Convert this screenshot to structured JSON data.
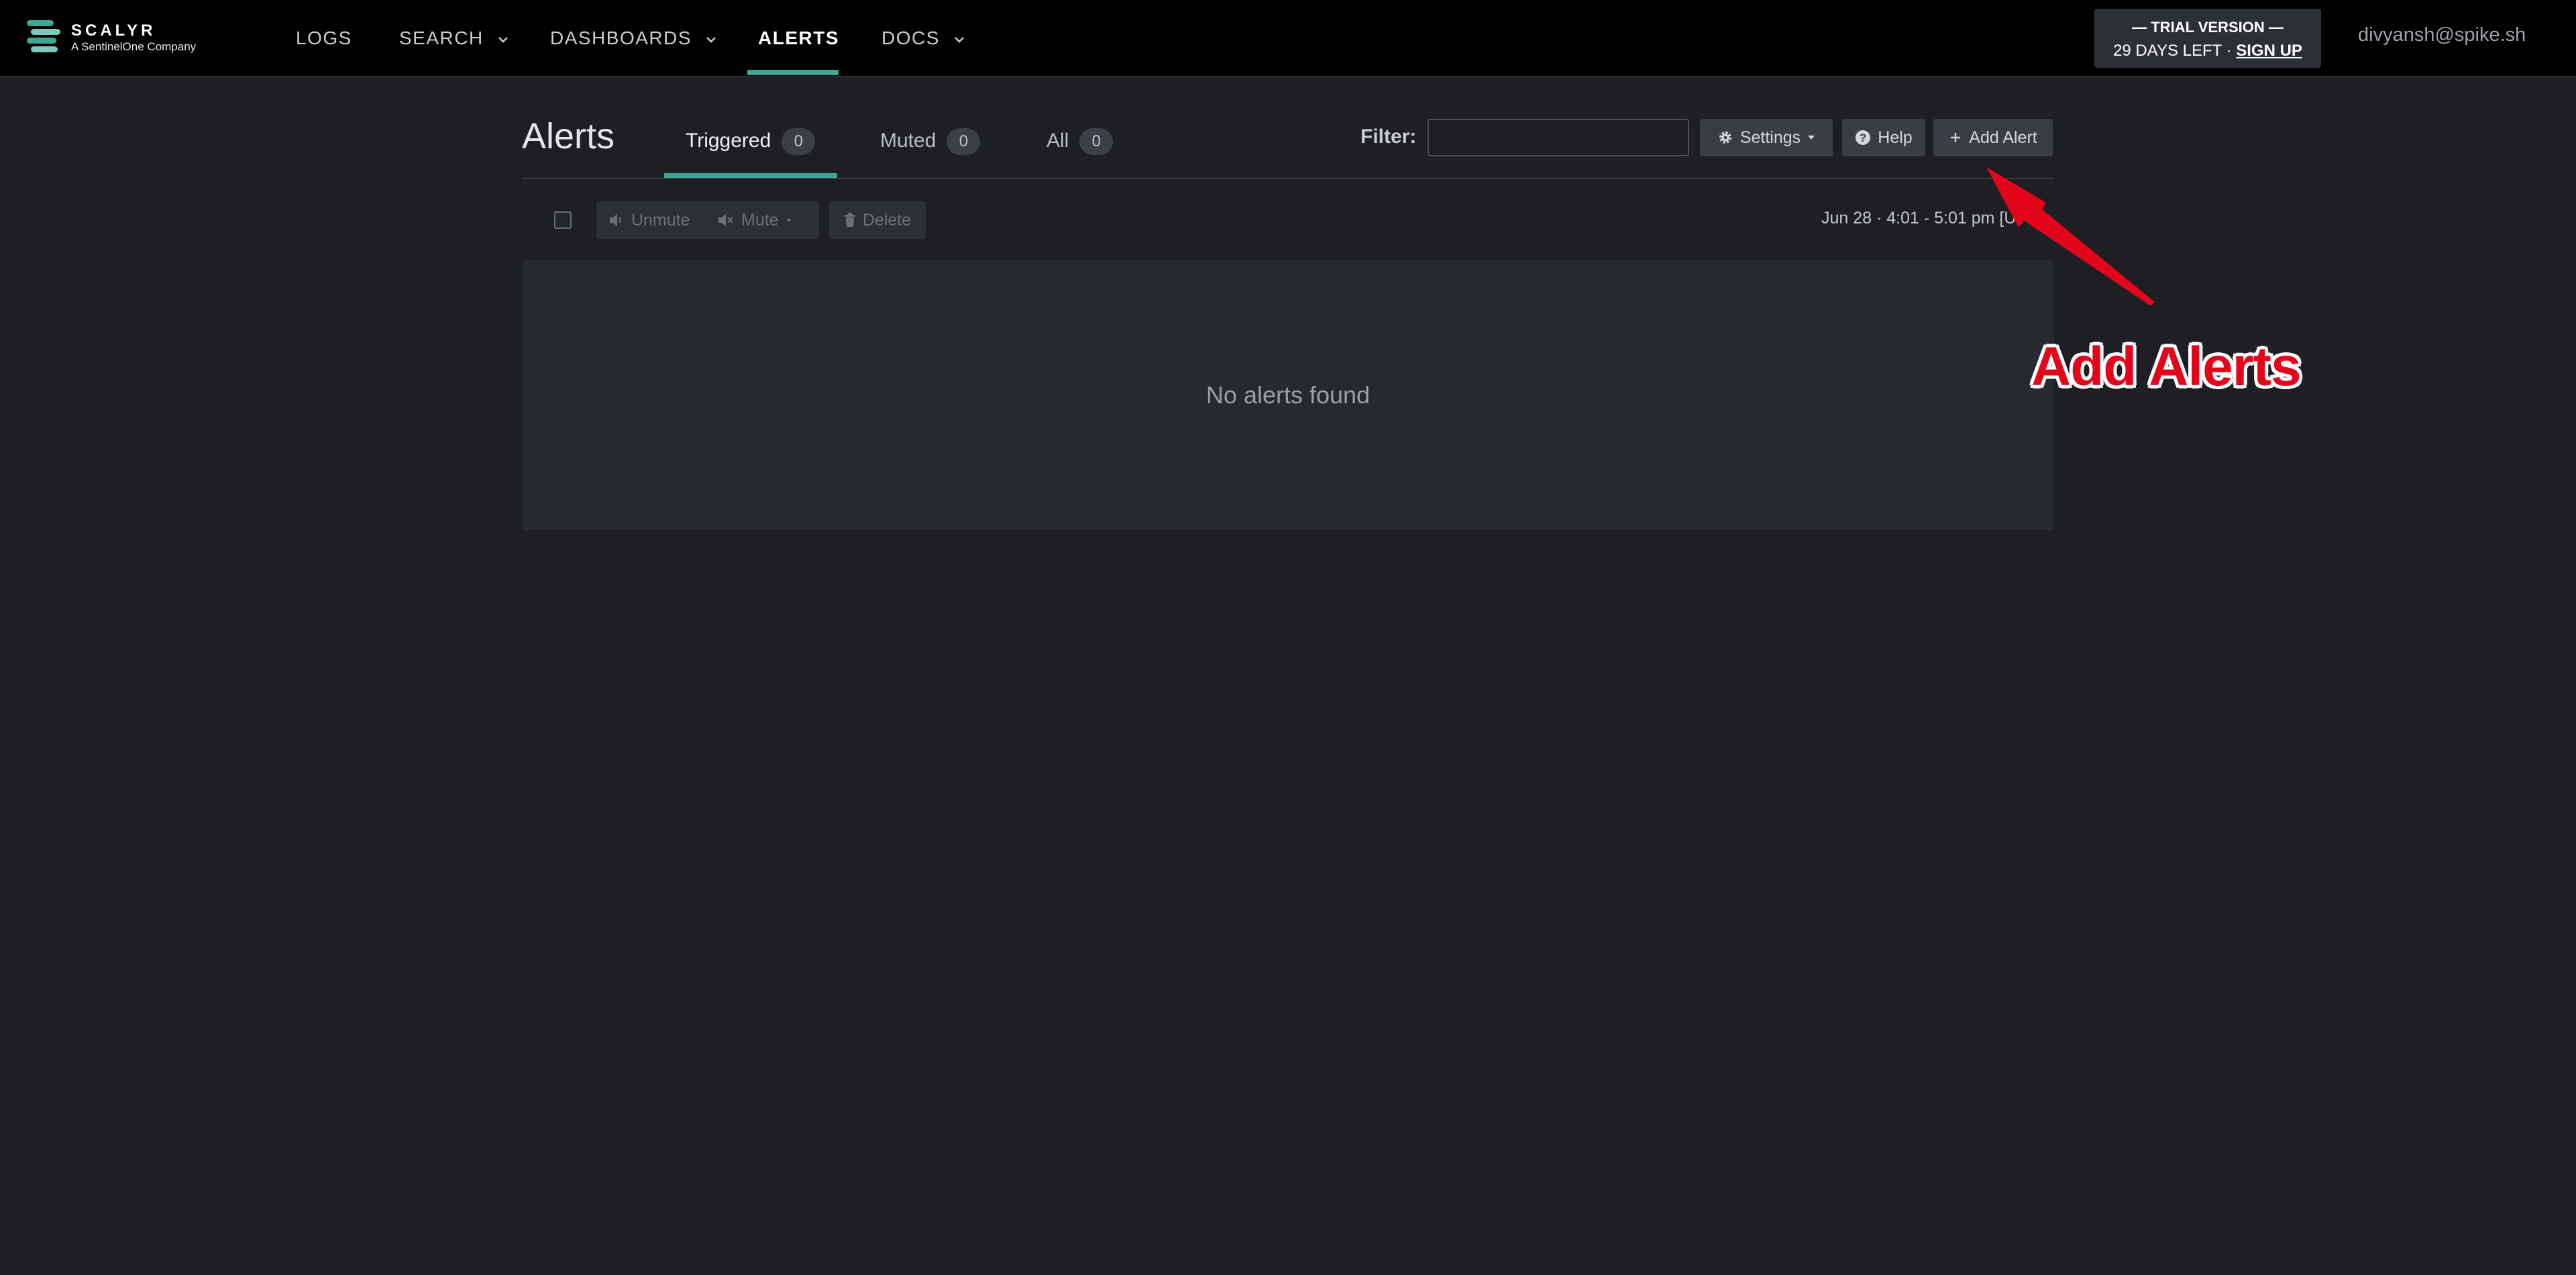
{
  "brand": {
    "name": "SCALYR",
    "tagline": "A SentinelOne Company",
    "accent_color": "#3fa696"
  },
  "nav": {
    "items": [
      {
        "label": "LOGS",
        "has_dropdown": false
      },
      {
        "label": "SEARCH",
        "has_dropdown": true
      },
      {
        "label": "DASHBOARDS",
        "has_dropdown": true
      },
      {
        "label": "ALERTS",
        "has_dropdown": false,
        "active": true
      },
      {
        "label": "DOCS",
        "has_dropdown": true
      }
    ]
  },
  "trial": {
    "title": "— TRIAL VERSION —",
    "days_left": "29 DAYS LEFT ·",
    "signup": "SIGN UP"
  },
  "user": {
    "email": "divyansh@spike.sh"
  },
  "page": {
    "title": "Alerts",
    "tabs": [
      {
        "label": "Triggered",
        "count": "0",
        "active": true
      },
      {
        "label": "Muted",
        "count": "0"
      },
      {
        "label": "All",
        "count": "0"
      }
    ],
    "filter": {
      "label": "Filter:",
      "value": "",
      "placeholder": ""
    },
    "buttons": {
      "settings": "Settings",
      "help": "Help",
      "add_alert": "Add Alert"
    }
  },
  "toolbar": {
    "unmute": "Unmute",
    "mute": "Mute",
    "delete": "Delete",
    "time_range": "Jun 28 · 4:01 - 5:01 pm [UTC+0"
  },
  "list": {
    "empty_message": "No alerts found"
  },
  "annotation": {
    "label": "Add Alerts",
    "color": "#e3061b"
  }
}
